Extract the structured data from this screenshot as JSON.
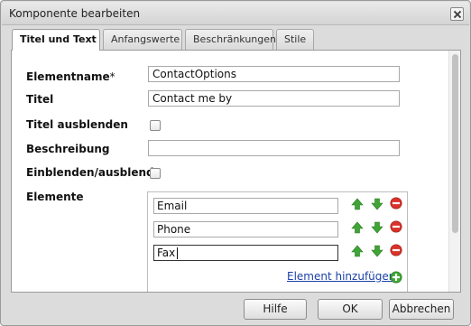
{
  "dialog": {
    "title": "Komponente bearbeiten"
  },
  "tabs": [
    {
      "label": "Titel und Text",
      "active": true
    },
    {
      "label": "Anfangswerte",
      "active": false
    },
    {
      "label": "Beschränkungen",
      "active": false
    },
    {
      "label": "Stile",
      "active": false
    }
  ],
  "form": {
    "elementname_label": "Elementname",
    "required_mark": "*",
    "elementname_value": "ContactOptions",
    "titel_label": "Titel",
    "titel_value": "Contact me by",
    "titel_ausblenden_label": "Titel ausblenden",
    "titel_ausblenden_checked": false,
    "beschreibung_label": "Beschreibung",
    "beschreibung_value": "",
    "einblenden_label": "Einblenden/ausblend",
    "einblenden_checked": false,
    "elemente_label": "Elemente"
  },
  "elements": {
    "items": [
      "Email",
      "Phone",
      "Fax"
    ],
    "add_label": "Element hinzufügen"
  },
  "buttons": {
    "help": "Hilfe",
    "ok": "OK",
    "cancel": "Abbrechen"
  },
  "colors": {
    "arrow_green": "#3fa535",
    "remove_red": "#d8322a",
    "link_blue": "#1a3fa8"
  },
  "icons": {
    "up": "arrow-up-icon",
    "down": "arrow-down-icon",
    "remove": "remove-icon",
    "add": "add-icon",
    "close": "close-icon"
  }
}
